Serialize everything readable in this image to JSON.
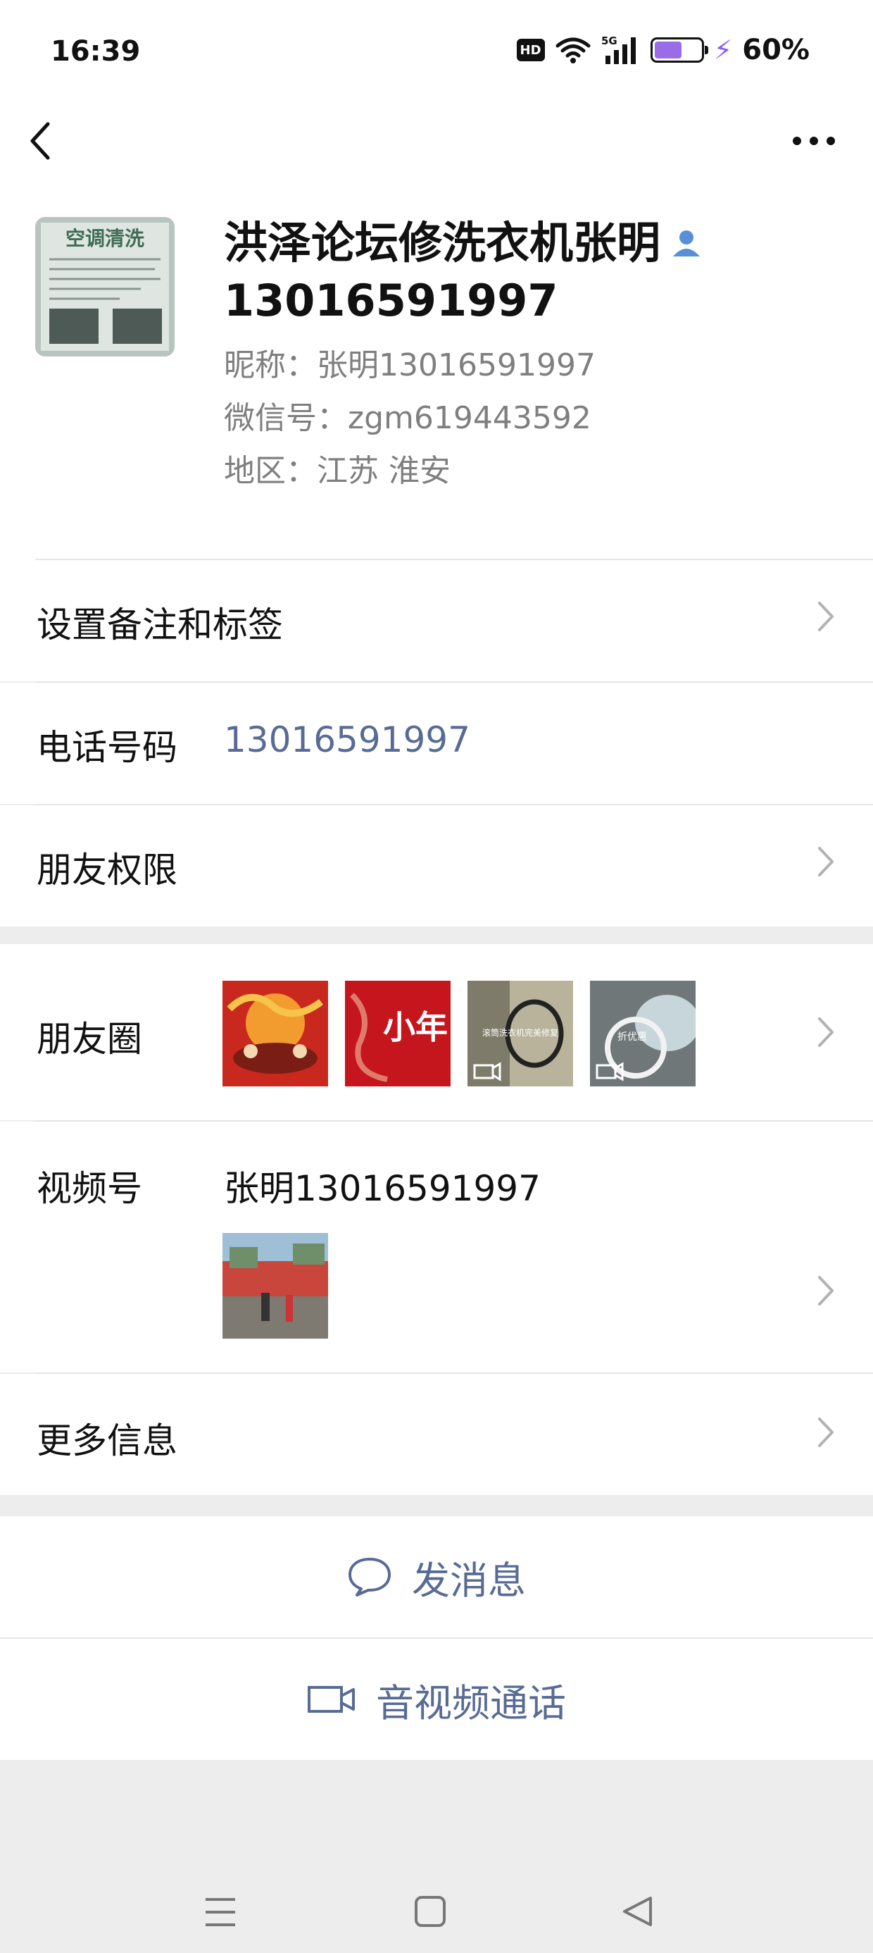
{
  "status_bar": {
    "time": "16:39",
    "hd_label": "HD",
    "network": "5G",
    "battery_percent": "60%",
    "battery_level": 0.6,
    "icons": [
      "hd-icon",
      "wifi-icon",
      "signal-icon",
      "battery-icon",
      "charging-icon"
    ]
  },
  "nav": {
    "back_icon": "chevron-left-icon",
    "more_icon": "more-horizontal-icon"
  },
  "profile": {
    "name": "洪泽论坛修洗衣机张明 13016591997",
    "name_part1": "洪泽论坛修洗衣机张明",
    "name_part2": "13016591997",
    "avatar_text": "空调清洗",
    "nickname": "昵称：张明13016591997",
    "wechat_id": "微信号：zgm619443592",
    "region": "地区：江苏  淮安"
  },
  "rows": {
    "remark_tags": "设置备注和标签",
    "phone_label": "电话号码",
    "phone_value": "13016591997",
    "friend_permissions": "朋友权限",
    "moments": "朋友圈",
    "channels_label": "视频号",
    "channels_name": "张明13016591997",
    "more_info": "更多信息"
  },
  "moments_thumbs": [
    {
      "caption": "",
      "video": false
    },
    {
      "caption": "小年",
      "video": false
    },
    {
      "caption": "滚筒洗衣机完美修复",
      "video": true
    },
    {
      "caption": "折优惠",
      "video": true
    }
  ],
  "actions": {
    "send_message": "发消息",
    "av_call": "音视频通话"
  },
  "colors": {
    "accent": "#576b95",
    "page_bg": "#ededed",
    "card_bg": "#ffffff",
    "battery_fill": "#9b6ce8"
  }
}
